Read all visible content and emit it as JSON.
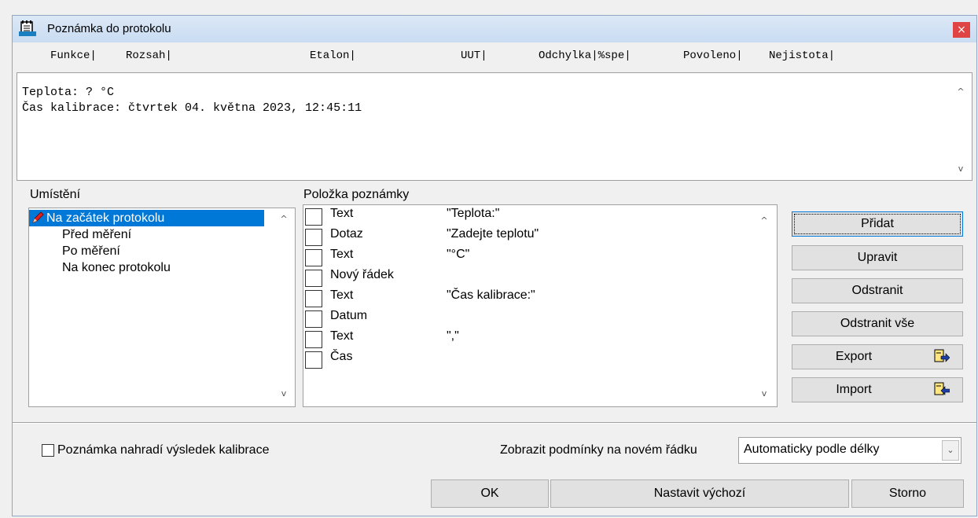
{
  "window": {
    "title": "Poznámka do protokolu",
    "close_glyph": "×"
  },
  "columns": [
    "Funkce|",
    "Rozsah|",
    "Etalon|",
    "UUT|",
    "Odchylka|%spe|",
    "Povoleno|",
    "Nejistota|"
  ],
  "memo": {
    "lines": [
      "Teplota: ? °C",
      "Čas kalibrace: čtvrtek 04. května 2023, 12:45:11"
    ]
  },
  "location": {
    "label": "Umístění",
    "items": [
      "Na začátek protokolu",
      "Před měření",
      "Po měření",
      "Na konec protokolu"
    ],
    "selected_index": 0
  },
  "note_items": {
    "label": "Položka poznámky",
    "rows": [
      {
        "type": "Text",
        "value": "\"Teplota:\""
      },
      {
        "type": "Dotaz",
        "value": "\"Zadejte teplotu\""
      },
      {
        "type": "Text",
        "value": "\"°C\""
      },
      {
        "type": "Nový řádek",
        "value": ""
      },
      {
        "type": "Text",
        "value": "\"Čas kalibrace:\""
      },
      {
        "type": "Datum",
        "value": ""
      },
      {
        "type": "Text",
        "value": "\",\""
      },
      {
        "type": "Čas",
        "value": ""
      }
    ]
  },
  "buttons": {
    "add": "Přidat",
    "edit": "Upravit",
    "remove": "Odstranit",
    "remove_all": "Odstranit vše",
    "export": "Export",
    "import": "Import",
    "ok": "OK",
    "set_default": "Nastavit výchozí",
    "cancel": "Storno"
  },
  "replace_checkbox": {
    "label": "Poznámka nahradí výsledek kalibrace",
    "checked": false
  },
  "conditions": {
    "label": "Zobrazit podmínky na novém řádku",
    "selected": "Automaticky podle délky"
  },
  "icons": {
    "scroll_up": "^",
    "scroll_down": "v",
    "combo_arrow": "⌄"
  },
  "colors": {
    "selection": "#0078d7",
    "close_button": "#e04343",
    "titlebar": "#c9dcf2"
  }
}
